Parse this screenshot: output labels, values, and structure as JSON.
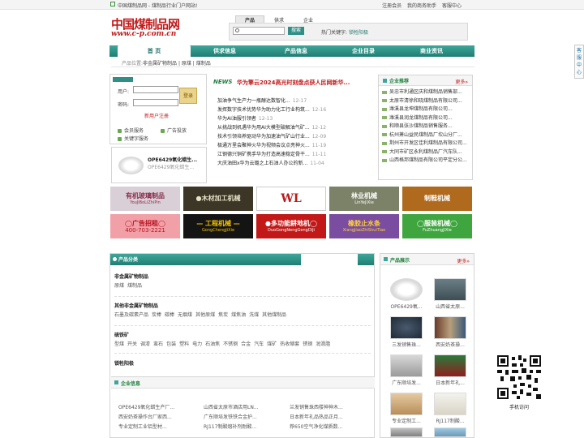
{
  "topbar": {
    "site": "中国煤制品网 - 煤制品行业门户网站!",
    "register": "注册会员",
    "biz": "我的商务助手",
    "service": "客服中心"
  },
  "logo": {
    "title": "中国煤制品网",
    "url": "www.c-p.com.cn"
  },
  "search": {
    "tabs": [
      "产品",
      "供求",
      "企业"
    ],
    "button": "搜索",
    "hot_label": "热门关键字:",
    "hot_keyword": "锁牲阳极"
  },
  "nav": [
    "首 页",
    "供求信息",
    "产品信息",
    "企业目录",
    "商业资讯"
  ],
  "breadcrumb": {
    "label": "产品位置:",
    "path": "非金属矿物制品 | 原煤 | 煤制品"
  },
  "login": {
    "user": "用户:",
    "pass": "密码:",
    "button": "登录",
    "register": "新用户注册"
  },
  "services": [
    "会员服务",
    "广告投放",
    "关键字服务"
  ],
  "featured": {
    "title": "OPE6429氧化蜡生...",
    "sub": "OPE6429氧化蜡生..."
  },
  "news": {
    "badge": "NEWS",
    "headline": "华为擎云2024高光时刻盘点获人民网新华...",
    "items": [
      {
        "t": "加油争气生产力一瓶醇达数智化...",
        "d": "12-17"
      },
      {
        "t": "发挥数字技术优势华为助力化工行业构筑...",
        "d": "12-16"
      },
      {
        "t": "华为AI油服引领者",
        "d": "12-13"
      },
      {
        "t": "从挑战到机遇华为用AI大模型破解油气矿...",
        "d": "12-12"
      },
      {
        "t": "技术引领培养驱动华为加速油气矿山行业...",
        "d": "12-09"
      },
      {
        "t": "极通万里会聚神火华为视频会议点亮神火...",
        "d": "11-19"
      },
      {
        "t": "江钢德兴铜矿携手华为打造高速稳定骨干...",
        "d": "11-11"
      },
      {
        "t": "大庆油田x华为云璐之上石油人办公的新...",
        "d": "11-04"
      }
    ]
  },
  "recommend": {
    "title": "企业推荐",
    "more": "更多»",
    "items": [
      "吴忠市利通区庆和煤制品销售部...",
      "太原市清徐和晓煤制品有限公司...",
      "潍溪县龙坤煤制品有限公司...",
      "潍溪县润龙煤制品有限公司...",
      "和顺县张沙煤制品销售服务...",
      "杭州萧山益民煤制品厂坎山分厂...",
      "荆州市开发区佳利煤制品有限公司...",
      "大同市矿区永利煤制品厂汽车队...",
      "山西格邦煤制品有限公司平定分公..."
    ]
  },
  "ads": [
    {
      "a1": "有机玻璃制品",
      "a2": "YouJiBoLiZhiPin",
      "bg": "#d8d0d6",
      "c": "#8a2c4a"
    },
    {
      "a1": "●木材加工机械",
      "a2": "",
      "bg": "#3b3626",
      "c": "#e8e2c8"
    },
    {
      "a1": "WL",
      "a2": "",
      "bg": "#ffffff",
      "c": "#b81c1c"
    },
    {
      "a1": "林业机械",
      "a2": "LinYeJiXie",
      "bg": "#7b8268",
      "c": "#ffffff"
    },
    {
      "a1": "制鞋机械",
      "a2": "",
      "bg": "#b06a1e",
      "c": "#ffffff"
    },
    {
      "a1": "◯广告招租◯",
      "a2": "400-703-2221",
      "bg": "#f2a0a8",
      "c": "#b5101c"
    },
    {
      "a1": "— 工程机械 —",
      "a2": "GongChengJiXie",
      "bg": "#141414",
      "c": "#f5c400"
    },
    {
      "a1": "●多功能耕地机◯",
      "a2": "DuoGongNengGengDiJi",
      "bg": "#c21818",
      "c": "#ffffff"
    },
    {
      "a1": "橡胶止水条",
      "a2": "XiangJiaoZhiShuiTiao",
      "bg": "#7a4da0",
      "c": "#ffd23a"
    },
    {
      "a1": "◯服装机械◯",
      "a2": "FuZhuangJiXie",
      "bg": "#3fa63f",
      "c": "#ffffff"
    }
  ],
  "categories": {
    "title": "产品分类",
    "groups": [
      {
        "h": "非金属矿物制品",
        "items": [
          "原煤",
          "煤制品"
        ]
      },
      {
        "h": "其他非金属矿物制品",
        "items": [
          "石墨及碳素产品",
          "炭棒",
          "碳棒",
          "无烟煤",
          "其他原煤",
          "焦炭",
          "煤焦油",
          "洗煤",
          "其他煤制品"
        ]
      },
      {
        "h": "硫铁矿",
        "items": [
          "型煤",
          "开关",
          "调漆",
          "蛮石",
          "包装",
          "塑料",
          "电力",
          "石油焦",
          "不锈钢",
          "合金",
          "汽车",
          "煤矿",
          "热收缩套",
          "锈钢",
          "润滑脂"
        ]
      },
      {
        "h": "锁牲阳极",
        "items": []
      }
    ]
  },
  "enterprise": {
    "title": "企业信息",
    "items": [
      "OPE6429氧化蜡生产厂...",
      "山西省太原市酒店用LN...",
      "兰发销售珠西楼神神木...",
      "西安奶茶操作台厂家西...",
      "广东顺培发铁铁合金护...",
      "日本新年礼品热品正月...",
      "专业定制工业铝型材...",
      "RJ117制酸熔补剂耐酸...",
      "荐650空气净化煤质数..."
    ]
  },
  "products": {
    "title": "产品展示",
    "more": "更多»",
    "items": [
      "OPE6429氧...",
      "山西省太原...",
      "三发销售珠...",
      "西安奶茶操...",
      "广东顺培发...",
      "日本新年礼...",
      "专业定制工...",
      "RJ117制酸...",
      ""
    ]
  },
  "side": "客服中心",
  "qr": {
    "caption": "手机访问"
  }
}
